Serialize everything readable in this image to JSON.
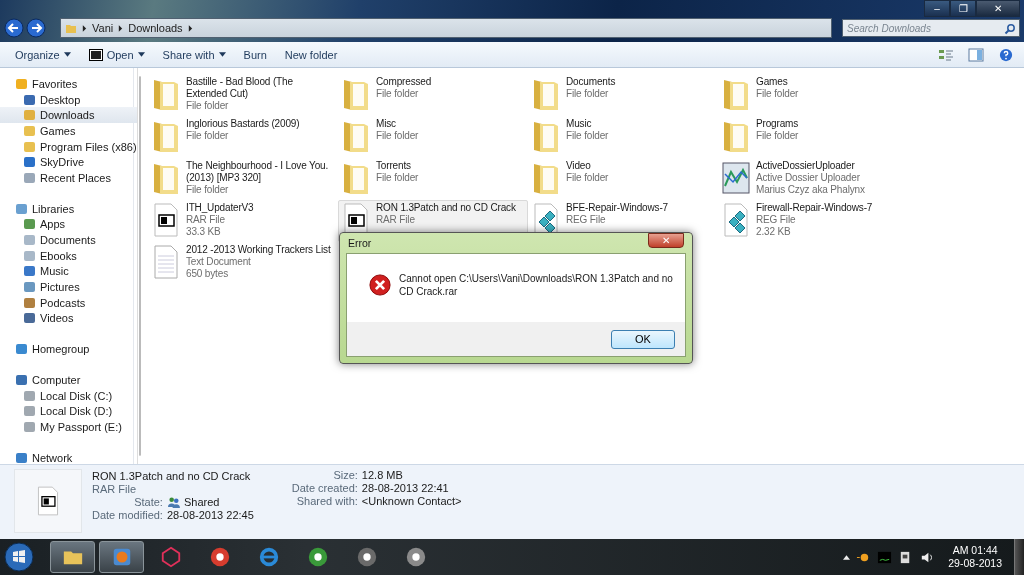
{
  "window": {
    "controls": [
      "–",
      "❐",
      "✕"
    ]
  },
  "address_bar": {
    "path": [
      "Vani",
      "Downloads"
    ]
  },
  "search": {
    "placeholder": "Search Downloads"
  },
  "toolbar": [
    {
      "label": "Organize",
      "kind": "menu"
    },
    {
      "label": "Open",
      "kind": "open"
    },
    {
      "label": "Share with",
      "kind": "menu"
    },
    {
      "label": "Burn",
      "kind": "plain"
    },
    {
      "label": "New folder",
      "kind": "plain"
    }
  ],
  "sidebar": [
    {
      "label": "Favorites",
      "kind": "star",
      "children": [
        {
          "label": "Desktop",
          "kind": "desktop",
          "selected": false
        },
        {
          "label": "Downloads",
          "kind": "downloads",
          "selected": true
        },
        {
          "label": "Games",
          "kind": "folder",
          "selected": false
        },
        {
          "label": "Program Files (x86)",
          "kind": "folder",
          "selected": false
        },
        {
          "label": "SkyDrive",
          "kind": "cloud",
          "selected": false
        },
        {
          "label": "Recent Places",
          "kind": "recent",
          "selected": false
        }
      ]
    },
    {
      "label": "Libraries",
      "kind": "library",
      "children": [
        {
          "label": "Apps",
          "kind": "apps",
          "selected": false
        },
        {
          "label": "Documents",
          "kind": "document",
          "selected": false
        },
        {
          "label": "Ebooks",
          "kind": "document",
          "selected": false
        },
        {
          "label": "Music",
          "kind": "music",
          "selected": false
        },
        {
          "label": "Pictures",
          "kind": "pictures",
          "selected": false
        },
        {
          "label": "Podcasts",
          "kind": "podcast",
          "selected": false
        },
        {
          "label": "Videos",
          "kind": "videos",
          "selected": false
        }
      ]
    },
    {
      "label": "Homegroup",
      "kind": "homegroup"
    },
    {
      "label": "Computer",
      "kind": "computer",
      "children": [
        {
          "label": "Local Disk (C:)",
          "kind": "disk",
          "selected": false
        },
        {
          "label": "Local Disk (D:)",
          "kind": "disk",
          "selected": false
        },
        {
          "label": "My Passport (E:)",
          "kind": "disk",
          "selected": false
        }
      ]
    },
    {
      "label": "Network",
      "kind": "network"
    }
  ],
  "files": [
    {
      "name": "Bastille - Bad Blood (The Extended Cut)",
      "lines": [
        "File folder"
      ],
      "kind": "folder",
      "selected": false
    },
    {
      "name": "Compressed",
      "lines": [
        "File folder"
      ],
      "kind": "folder",
      "selected": false
    },
    {
      "name": "Documents",
      "lines": [
        "File folder"
      ],
      "kind": "folder",
      "selected": false
    },
    {
      "name": "Games",
      "lines": [
        "File folder"
      ],
      "kind": "folder",
      "selected": false
    },
    {
      "name": "Inglorious Bastards (2009)",
      "lines": [
        "File folder"
      ],
      "kind": "folder",
      "selected": false
    },
    {
      "name": "Misc",
      "lines": [
        "File folder"
      ],
      "kind": "folder",
      "selected": false
    },
    {
      "name": "Music",
      "lines": [
        "File folder"
      ],
      "kind": "folder",
      "selected": false
    },
    {
      "name": "Programs",
      "lines": [
        "File folder"
      ],
      "kind": "folder",
      "selected": false
    },
    {
      "name": "The Neighbourhood - I Love You. (2013) [MP3 320]",
      "lines": [
        "File folder"
      ],
      "kind": "folder",
      "selected": false
    },
    {
      "name": "Torrents",
      "lines": [
        "File folder"
      ],
      "kind": "folder",
      "selected": false
    },
    {
      "name": "Video",
      "lines": [
        "File folder"
      ],
      "kind": "folder",
      "selected": false
    },
    {
      "name": "ActiveDossierUploader",
      "lines": [
        "Active Dossier Uploader",
        "Marius Czyz aka Phalynx"
      ],
      "kind": "app",
      "selected": false
    },
    {
      "name": "ITH_UpdaterV3",
      "lines": [
        "RAR File",
        "33.3 KB"
      ],
      "kind": "rar",
      "selected": false
    },
    {
      "name": "RON 1.3Patch and no CD Crack",
      "lines": [
        "RAR File"
      ],
      "kind": "rar",
      "selected": true
    },
    {
      "name": "BFE-Repair-Windows-7",
      "lines": [
        "REG File"
      ],
      "kind": "reg",
      "selected": false
    },
    {
      "name": "Firewall-Repair-Windows-7",
      "lines": [
        "REG File",
        "2.32 KB"
      ],
      "kind": "reg",
      "selected": false
    },
    {
      "name": "2012 -2013 Working Trackers List",
      "lines": [
        "Text Document",
        "650 bytes"
      ],
      "kind": "text",
      "selected": false
    }
  ],
  "dialog": {
    "title": "Error",
    "close": "✕",
    "message": "Cannot open C:\\Users\\Vani\\Downloads\\RON 1.3Patch and no CD Crack.rar",
    "button": "OK"
  },
  "details": {
    "name": "RON 1.3Patch and no CD Crack",
    "type": "RAR File",
    "left": [
      {
        "label": "State:",
        "value": "Shared",
        "kind": "shared"
      },
      {
        "label": "Date modified:",
        "value": "28-08-2013 22:45",
        "kind": "plain"
      }
    ],
    "right": [
      {
        "label": "Size:",
        "value": "12.8 MB"
      },
      {
        "label": "Date created:",
        "value": "28-08-2013 22:41"
      },
      {
        "label": "Shared with:",
        "value": "<Unknown Contact>"
      }
    ]
  },
  "taskbar": {
    "apps": [
      {
        "kind": "explorer",
        "running": true
      },
      {
        "kind": "player",
        "running": true
      },
      {
        "kind": "zune",
        "running": false
      },
      {
        "kind": "chrome",
        "running": false
      },
      {
        "kind": "ie",
        "running": false
      },
      {
        "kind": "utorrent",
        "running": false
      },
      {
        "kind": "steam",
        "running": false
      },
      {
        "kind": "wot",
        "running": false
      }
    ],
    "clock": {
      "time": "AM 01:44",
      "date": "29-08-2013"
    }
  }
}
